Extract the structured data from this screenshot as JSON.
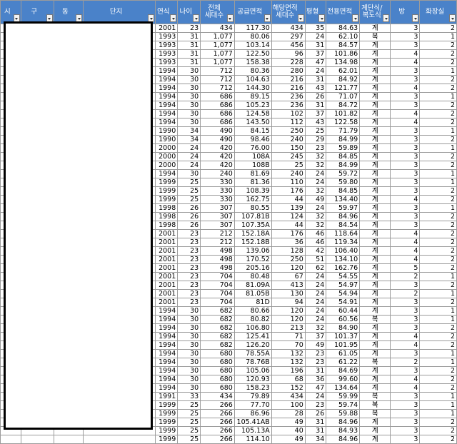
{
  "headers": [
    {
      "label": "시"
    },
    {
      "label": "구"
    },
    {
      "label": "동"
    },
    {
      "label": "단지"
    },
    {
      "label": "연식"
    },
    {
      "label": "나이"
    },
    {
      "label": "전체\n세대수"
    },
    {
      "label": "공급면적"
    },
    {
      "label": "해당면적\n세대수"
    },
    {
      "label": "평형"
    },
    {
      "label": "전용면적"
    },
    {
      "label": "계단식/\n복도식"
    },
    {
      "label": "방"
    },
    {
      "label": "화장실"
    }
  ],
  "rows": [
    [
      "2001",
      "23",
      "434",
      "117.30",
      "434",
      "35",
      "84.63",
      "계",
      "3",
      "2"
    ],
    [
      "1993",
      "31",
      "1,077",
      "80.06",
      "297",
      "24",
      "62.10",
      "복",
      "3",
      "1"
    ],
    [
      "1993",
      "31",
      "1,077",
      "103.14",
      "456",
      "31",
      "84.57",
      "계",
      "3",
      "2"
    ],
    [
      "1993",
      "31",
      "1,077",
      "122.50",
      "96",
      "37",
      "101.86",
      "계",
      "4",
      "2"
    ],
    [
      "1993",
      "31",
      "1,077",
      "158.38",
      "228",
      "47",
      "134.98",
      "계",
      "4",
      "2"
    ],
    [
      "1994",
      "30",
      "712",
      "80.36",
      "280",
      "24",
      "62.01",
      "계",
      "3",
      "1"
    ],
    [
      "1994",
      "30",
      "712",
      "104.63",
      "216",
      "31",
      "84.92",
      "계",
      "3",
      "2"
    ],
    [
      "1994",
      "30",
      "712",
      "144.30",
      "216",
      "43",
      "121.77",
      "계",
      "4",
      "2"
    ],
    [
      "1994",
      "30",
      "686",
      "89.15",
      "236",
      "26",
      "71.07",
      "계",
      "3",
      "1"
    ],
    [
      "1994",
      "30",
      "686",
      "105.23",
      "236",
      "31",
      "84.72",
      "계",
      "3",
      "2"
    ],
    [
      "1994",
      "30",
      "686",
      "124.58",
      "102",
      "37",
      "101.82",
      "계",
      "4",
      "2"
    ],
    [
      "1994",
      "30",
      "686",
      "143.50",
      "112",
      "43",
      "122.58",
      "계",
      "4",
      "2"
    ],
    [
      "1990",
      "34",
      "490",
      "84.15",
      "250",
      "25",
      "71.79",
      "계",
      "3",
      "1"
    ],
    [
      "1990",
      "34",
      "490",
      "98.46",
      "240",
      "29",
      "84.99",
      "계",
      "3",
      "2"
    ],
    [
      "2000",
      "24",
      "420",
      "76.00",
      "150",
      "23",
      "59.89",
      "계",
      "3",
      "1"
    ],
    [
      "2000",
      "24",
      "420",
      "108A",
      "245",
      "32",
      "84.85",
      "계",
      "3",
      "2"
    ],
    [
      "2000",
      "24",
      "420",
      "108B",
      "25",
      "32",
      "84.99",
      "계",
      "3",
      "2"
    ],
    [
      "1994",
      "30",
      "240",
      "81.69",
      "240",
      "24",
      "59.72",
      "계",
      "3",
      "1"
    ],
    [
      "1999",
      "25",
      "330",
      "81.36",
      "110",
      "24",
      "59.80",
      "계",
      "3",
      "1"
    ],
    [
      "1999",
      "25",
      "330",
      "108.39",
      "176",
      "32",
      "84.85",
      "계",
      "3",
      "2"
    ],
    [
      "1999",
      "25",
      "330",
      "162.75",
      "44",
      "49",
      "134.40",
      "계",
      "4",
      "2"
    ],
    [
      "1998",
      "26",
      "307",
      "80.55",
      "139",
      "24",
      "59.97",
      "계",
      "3",
      "1"
    ],
    [
      "1998",
      "26",
      "307",
      "107.81B",
      "124",
      "32",
      "84.96",
      "계",
      "3",
      "2"
    ],
    [
      "1998",
      "26",
      "307",
      "107.35A",
      "44",
      "32",
      "84.54",
      "계",
      "3",
      "2"
    ],
    [
      "2001",
      "23",
      "212",
      "152.18A",
      "176",
      "46",
      "118.64",
      "계",
      "4",
      "2"
    ],
    [
      "2001",
      "23",
      "212",
      "152.18B",
      "36",
      "46",
      "119.34",
      "계",
      "4",
      "2"
    ],
    [
      "2001",
      "23",
      "498",
      "139.06",
      "128",
      "42",
      "106.40",
      "계",
      "4",
      "2"
    ],
    [
      "2001",
      "23",
      "498",
      "170.52",
      "250",
      "51",
      "134.10",
      "계",
      "4",
      "2"
    ],
    [
      "2001",
      "23",
      "498",
      "205.16",
      "120",
      "62",
      "162.76",
      "계",
      "5",
      "2"
    ],
    [
      "2001",
      "23",
      "704",
      "80.48",
      "67",
      "24",
      "54.55",
      "계",
      "2",
      "1"
    ],
    [
      "2001",
      "23",
      "704",
      "81.09A",
      "413",
      "24",
      "54.97",
      "계",
      "3",
      "2"
    ],
    [
      "2001",
      "23",
      "704",
      "81.05B",
      "130",
      "24",
      "54.94",
      "계",
      "2",
      "1"
    ],
    [
      "2001",
      "23",
      "704",
      "81D",
      "94",
      "24",
      "54.91",
      "계",
      "3",
      "2"
    ],
    [
      "1994",
      "30",
      "682",
      "80.66",
      "120",
      "24",
      "60.44",
      "계",
      "3",
      "1"
    ],
    [
      "1994",
      "30",
      "682",
      "80.82",
      "120",
      "24",
      "60.56",
      "복",
      "3",
      "1"
    ],
    [
      "1994",
      "30",
      "682",
      "106.80",
      "213",
      "32",
      "84.90",
      "계",
      "3",
      "2"
    ],
    [
      "1994",
      "30",
      "682",
      "125.41",
      "71",
      "37",
      "101.37",
      "계",
      "4",
      "2"
    ],
    [
      "1994",
      "30",
      "682",
      "126.20",
      "70",
      "49",
      "101.95",
      "계",
      "4",
      "2"
    ],
    [
      "1994",
      "30",
      "680",
      "78.55A",
      "132",
      "23",
      "61.05",
      "계",
      "3",
      "1"
    ],
    [
      "1994",
      "30",
      "680",
      "78.76B",
      "132",
      "23",
      "61.22",
      "복",
      "2",
      "1"
    ],
    [
      "1994",
      "30",
      "680",
      "105.06",
      "196",
      "31",
      "84.69",
      "계",
      "3",
      "2"
    ],
    [
      "1994",
      "30",
      "680",
      "120.93",
      "68",
      "36",
      "99.60",
      "계",
      "4",
      "2"
    ],
    [
      "1994",
      "30",
      "680",
      "158.23",
      "152",
      "47",
      "134.64",
      "계",
      "4",
      "2"
    ],
    [
      "1991",
      "33",
      "434",
      "79.89",
      "434",
      "24",
      "59.99",
      "복",
      "3",
      "1"
    ],
    [
      "1999",
      "25",
      "266",
      "77.70",
      "100",
      "23",
      "59.74",
      "복",
      "3",
      "1"
    ],
    [
      "1999",
      "25",
      "266",
      "86.96",
      "28",
      "26",
      "59.88",
      "복",
      "3",
      "1"
    ],
    [
      "1999",
      "25",
      "266",
      "105.41AB",
      "49",
      "31",
      "84.96",
      "계",
      "3",
      "2"
    ],
    [
      "1999",
      "25",
      "266",
      "105.13A",
      "40",
      "31",
      "84.93",
      "계",
      "3",
      "2"
    ],
    [
      "1999",
      "25",
      "266",
      "114.10",
      "49",
      "34",
      "84.96",
      "계",
      "3",
      "2"
    ]
  ]
}
